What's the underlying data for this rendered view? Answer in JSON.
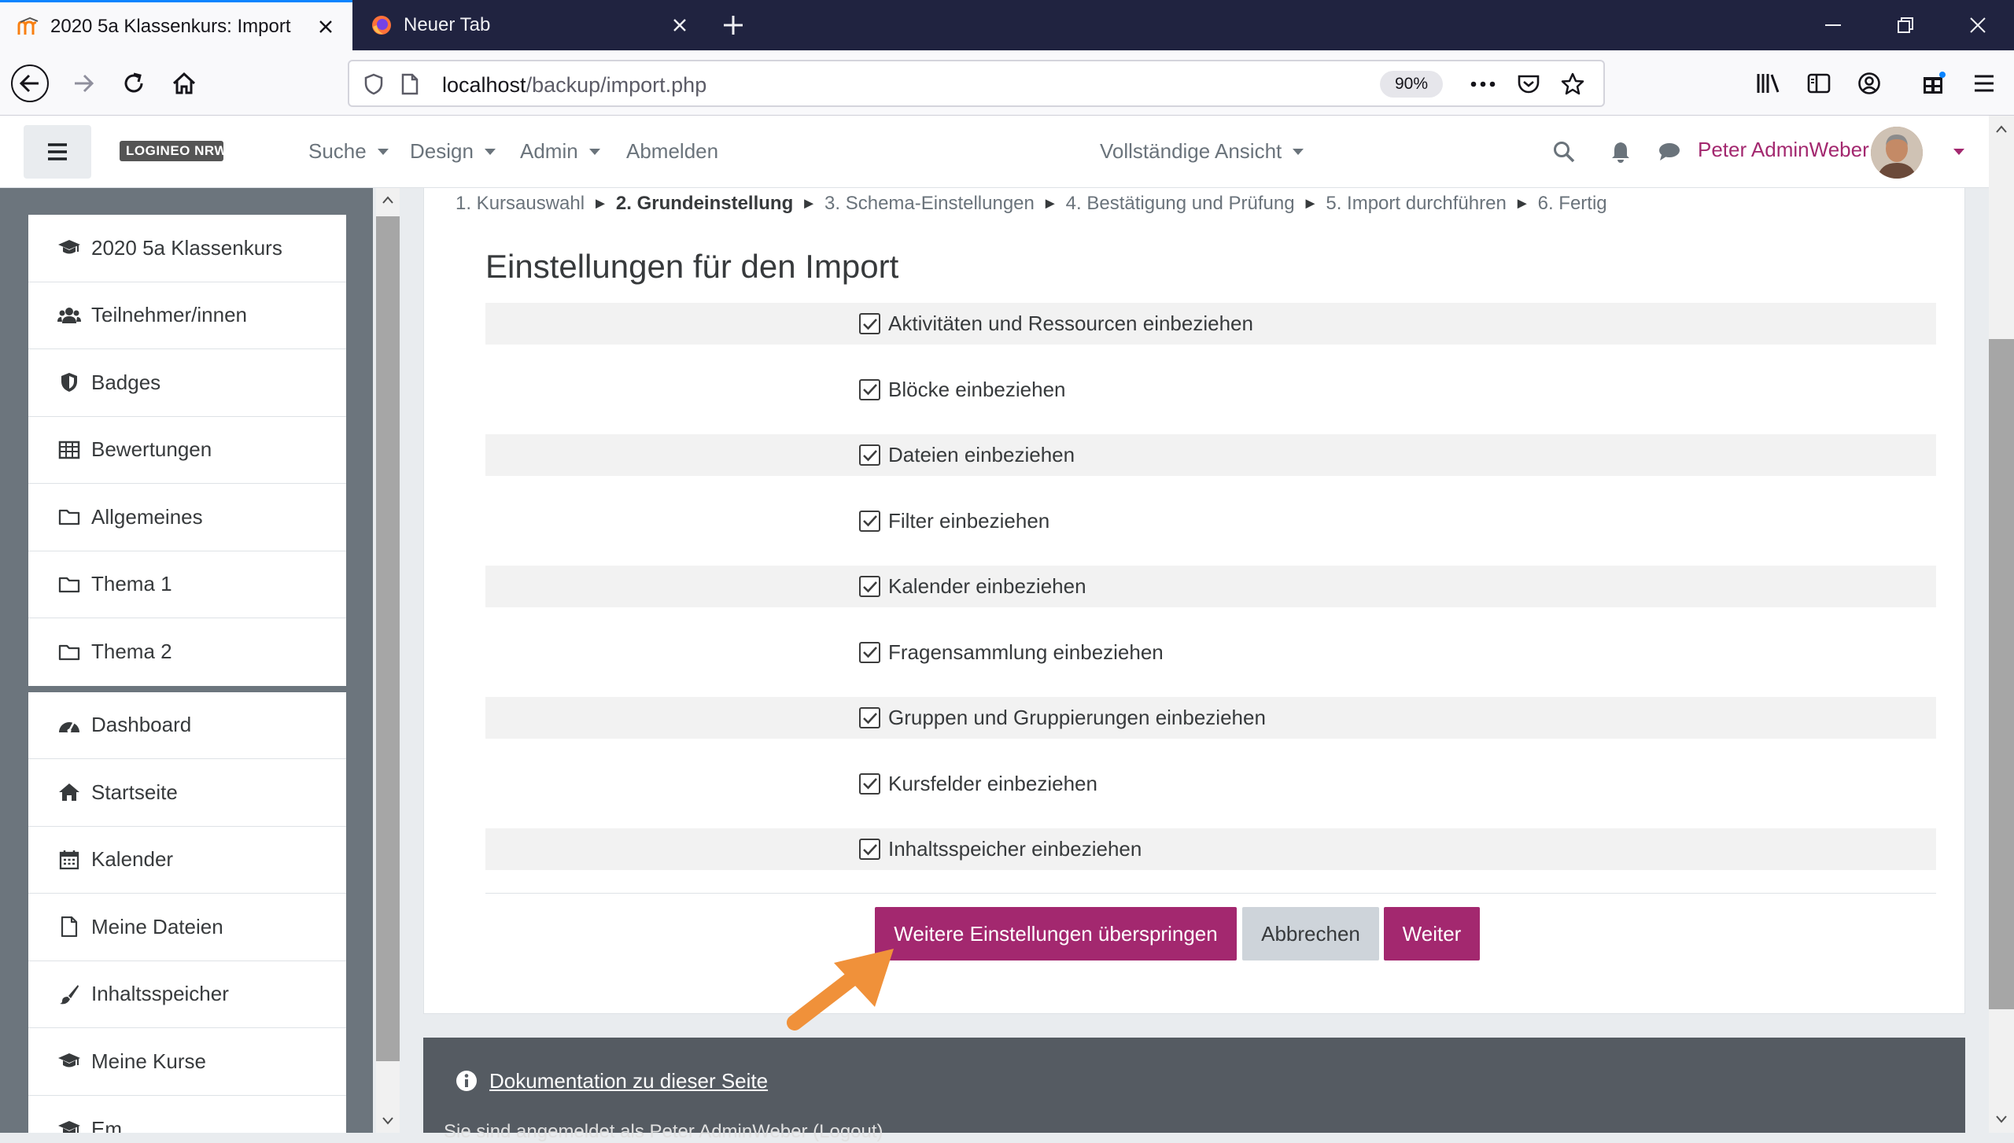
{
  "browser": {
    "tabs": [
      {
        "title": "2020 5a Klassenkurs: Import",
        "active": true
      },
      {
        "title": "Neuer Tab",
        "active": false
      }
    ],
    "url_host": "localhost",
    "url_path": "/backup/import.php",
    "zoom": "90%"
  },
  "header": {
    "logo_text": "LOGINEO NRW",
    "menu": [
      "Suche",
      "Design",
      "Admin",
      "Abmelden"
    ],
    "view_mode": "Vollständige Ansicht",
    "user_name": "Peter AdminWeber"
  },
  "drawer": {
    "course_items": [
      {
        "label": "2020 5a Klassenkurs",
        "icon": "graduation-cap-icon"
      },
      {
        "label": "Teilnehmer/innen",
        "icon": "users-icon"
      },
      {
        "label": "Badges",
        "icon": "shield-icon"
      },
      {
        "label": "Bewertungen",
        "icon": "table-icon"
      },
      {
        "label": "Allgemeines",
        "icon": "folder-icon"
      },
      {
        "label": "Thema 1",
        "icon": "folder-icon"
      },
      {
        "label": "Thema 2",
        "icon": "folder-icon"
      }
    ],
    "site_items": [
      {
        "label": "Dashboard",
        "icon": "dashboard-icon"
      },
      {
        "label": "Startseite",
        "icon": "home-icon"
      },
      {
        "label": "Kalender",
        "icon": "calendar-icon"
      },
      {
        "label": "Meine Dateien",
        "icon": "file-icon"
      },
      {
        "label": "Inhaltsspeicher",
        "icon": "brush-icon"
      },
      {
        "label": "Meine Kurse",
        "icon": "graduation-cap-icon"
      },
      {
        "label": "Em...",
        "icon": "graduation-cap-icon"
      }
    ]
  },
  "breadcrumb": {
    "steps": [
      "1. Kursauswahl",
      "2. Grundeinstellung",
      "3. Schema-Einstellungen",
      "4. Bestätigung und Prüfung",
      "5. Import durchführen",
      "6. Fertig"
    ],
    "current_index": 1,
    "separator": "►"
  },
  "page": {
    "title": "Einstellungen für den Import",
    "options": [
      {
        "label": "Aktivitäten und Ressourcen einbeziehen",
        "checked": true
      },
      {
        "label": "Blöcke einbeziehen",
        "checked": true
      },
      {
        "label": "Dateien einbeziehen",
        "checked": true
      },
      {
        "label": "Filter einbeziehen",
        "checked": true
      },
      {
        "label": "Kalender einbeziehen",
        "checked": true
      },
      {
        "label": "Fragensammlung einbeziehen",
        "checked": true
      },
      {
        "label": "Gruppen und Gruppierungen einbeziehen",
        "checked": true
      },
      {
        "label": "Kursfelder einbeziehen",
        "checked": true
      },
      {
        "label": "Inhaltsspeicher einbeziehen",
        "checked": true
      }
    ],
    "buttons": {
      "skip": "Weitere Einstellungen überspringen",
      "cancel": "Abbrechen",
      "next": "Weiter"
    }
  },
  "footer": {
    "doc_link": "Dokumentation zu dieser Seite",
    "logged_in": "Sie sind angemeldet als Peter AdminWeber (Logout)"
  },
  "colors": {
    "brand": "#a3286f",
    "annotation_arrow": "#f0913a"
  }
}
